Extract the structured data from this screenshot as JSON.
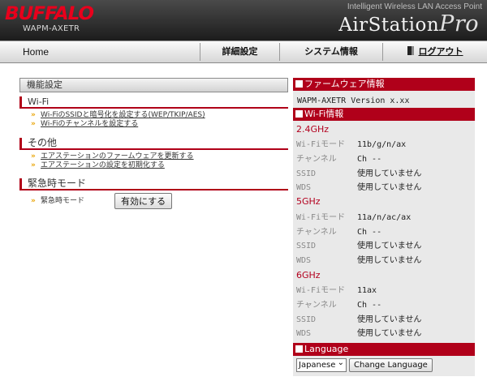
{
  "header": {
    "logo": "BUFFALO",
    "model": "WAPM-AXETR",
    "tagline": "Intelligent Wireless LAN Access Point",
    "brand_main": "AirStation",
    "brand_pro": "Pro"
  },
  "nav": {
    "home": "Home",
    "detail": "詳細設定",
    "system": "システム情報",
    "logout": "ログアウト"
  },
  "left": {
    "title": "機能設定",
    "wifi": {
      "heading": "Wi-Fi",
      "links": [
        "Wi-FiのSSIDと暗号化を設定する(WEP/TKIP/AES)",
        "Wi-Fiのチャンネルを設定する"
      ]
    },
    "other": {
      "heading": "その他",
      "links": [
        "エアステーションのファームウェアを更新する",
        "エアステーションの設定を初期化する"
      ]
    },
    "emergency": {
      "heading": "緊急時モード",
      "label": "緊急時モード",
      "button": "有効にする"
    }
  },
  "right": {
    "firmware": {
      "heading": "ファームウェア情報",
      "value": "WAPM-AXETR Version x.xx"
    },
    "wifi_info": {
      "heading": "Wi-Fi情報",
      "bands": [
        {
          "name": "2.4GHz",
          "mode_label": "Wi-Fiモード",
          "mode": "11b/g/n/ax",
          "ch_label": "チャンネル",
          "ch": "Ch --",
          "ssid_label": "SSID",
          "ssid": "使用していません",
          "wds_label": "WDS",
          "wds": "使用していません"
        },
        {
          "name": "5GHz",
          "mode_label": "Wi-Fiモード",
          "mode": "11a/n/ac/ax",
          "ch_label": "チャンネル",
          "ch": "Ch --",
          "ssid_label": "SSID",
          "ssid": "使用していません",
          "wds_label": "WDS",
          "wds": "使用していません"
        },
        {
          "name": "6GHz",
          "mode_label": "Wi-Fiモード",
          "mode": "11ax",
          "ch_label": "チャンネル",
          "ch": "Ch --",
          "ssid_label": "SSID",
          "ssid": "使用していません",
          "wds_label": "WDS",
          "wds": "使用していません"
        }
      ]
    },
    "language": {
      "heading": "Language",
      "selected": "Japanese",
      "button": "Change Language"
    }
  },
  "colors": {
    "accent_red": "#b0001a",
    "logo_red": "#e8001c",
    "arrow_orange": "#e8a200"
  }
}
